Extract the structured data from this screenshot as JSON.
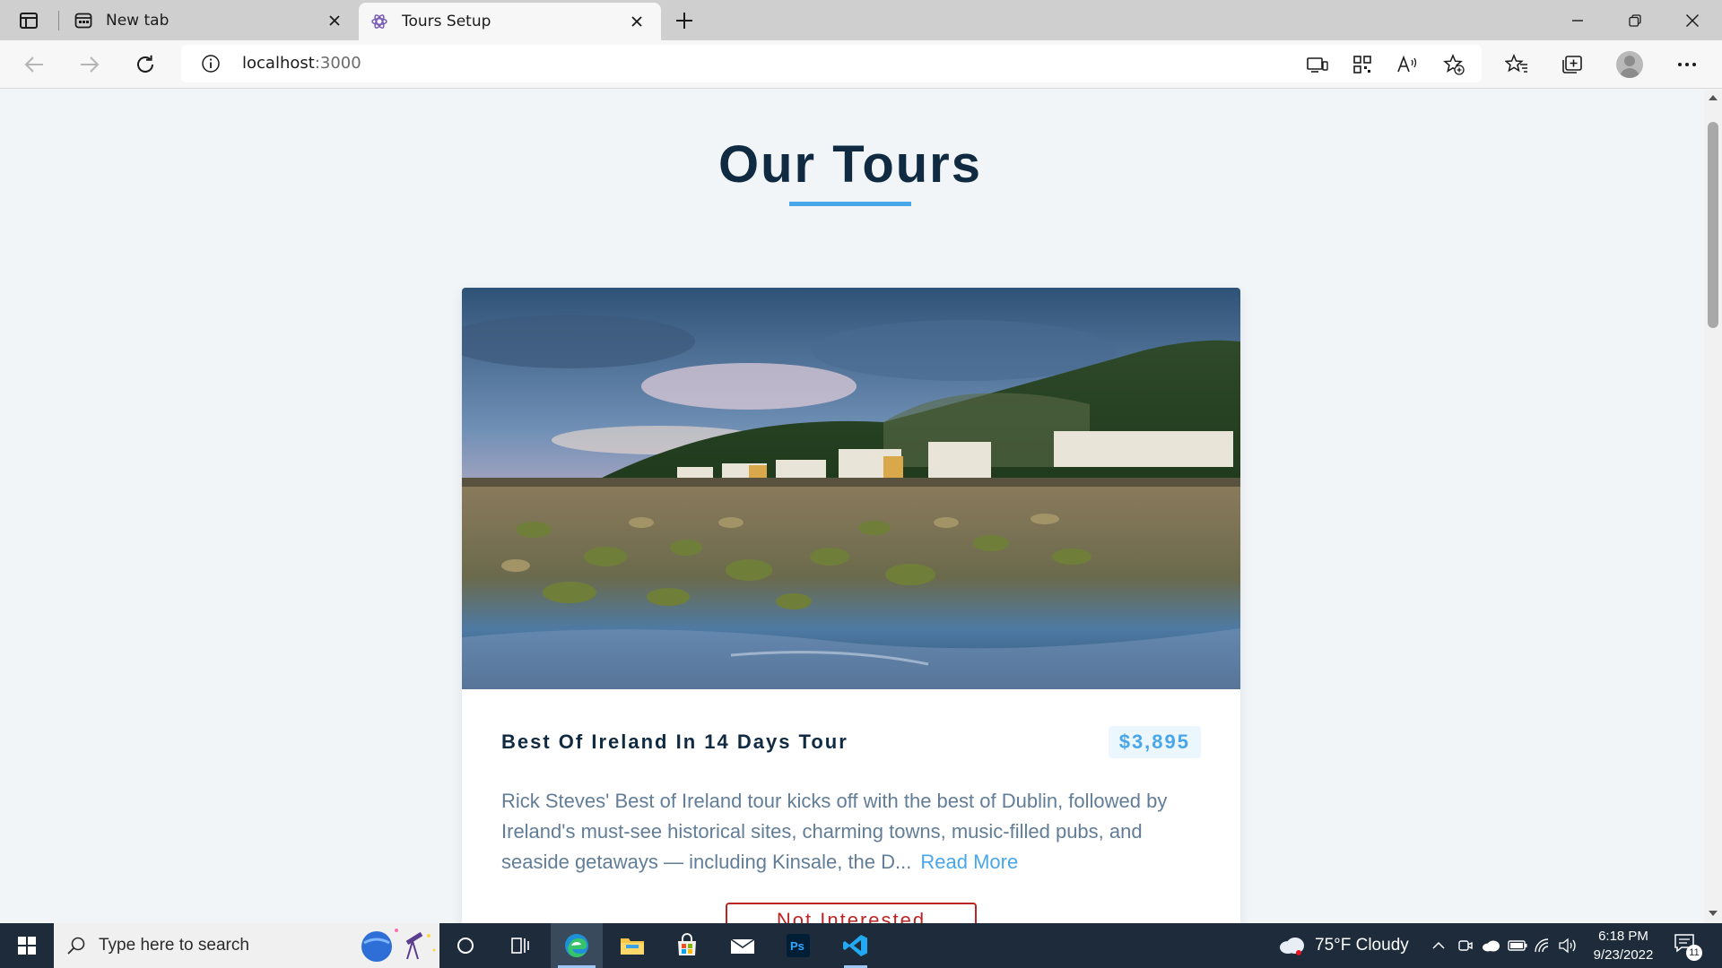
{
  "browser": {
    "tabs": [
      {
        "title": "New tab",
        "active": false,
        "icon": "newtab-icon"
      },
      {
        "title": "Tours Setup",
        "active": true,
        "icon": "tours-favicon"
      }
    ],
    "url_host": "localhost",
    "url_port": ":3000"
  },
  "page": {
    "heading": "Our Tours",
    "accent_color": "#49a6e9",
    "card": {
      "name": "Best Of Ireland In 14 Days Tour",
      "price": "$3,895",
      "description": "Rick Steves' Best of Ireland tour kicks off with the best of Dublin, followed by Ireland's must-see historical sites, charming towns, music-filled pubs, and seaside getaways — including Kinsale, the D...",
      "read_more": "Read More",
      "not_interested": "Not Interested",
      "image_desc": "coastal village with rocky shoreline and tide pools"
    }
  },
  "taskbar": {
    "search_placeholder": "Type here to search",
    "weather": "75°F  Cloudy",
    "time": "6:18 PM",
    "date": "9/23/2022",
    "notification_count": "11"
  }
}
